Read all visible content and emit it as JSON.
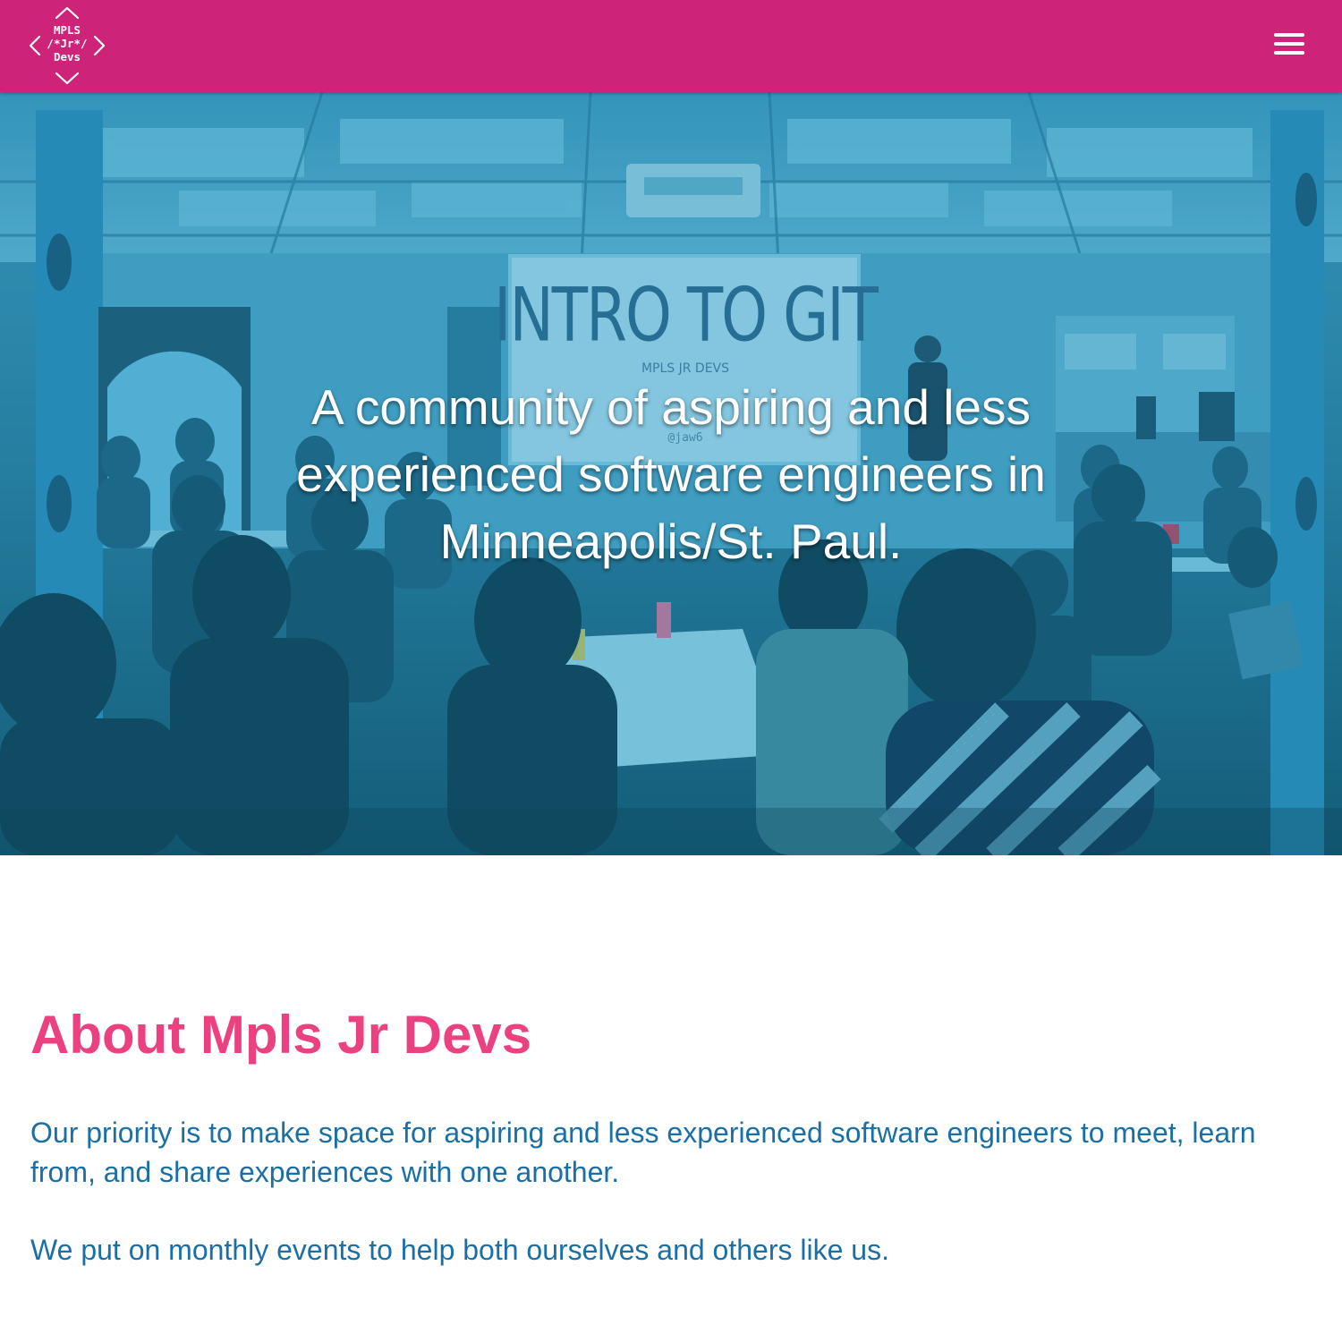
{
  "header": {
    "logo": {
      "line1": "MPLS",
      "line2": "/*Jr*/",
      "line3": "Devs",
      "wrapper_left": "<",
      "wrapper_right": ">"
    },
    "menu_icon": "hamburger-icon",
    "background_color": "#cd2479"
  },
  "hero": {
    "tagline": "A community of aspiring and less experienced software engineers in Minneapolis/St. Paul.",
    "photo_screen_title": "INTRO TO GIT",
    "photo_screen_subtitle": "MPLS JR DEVS",
    "photo_screen_handle": "@jaw6",
    "tint_color": "#1a7fa3"
  },
  "about": {
    "title": "About Mpls Jr Devs",
    "paragraph1": "Our priority is to make space for aspiring and less experienced software engineers to meet, learn from, and share experiences with one another.",
    "paragraph2": "We put on monthly events to help both ourselves and others like us.",
    "title_color": "#ec4181",
    "text_color": "#1a6fa6"
  }
}
